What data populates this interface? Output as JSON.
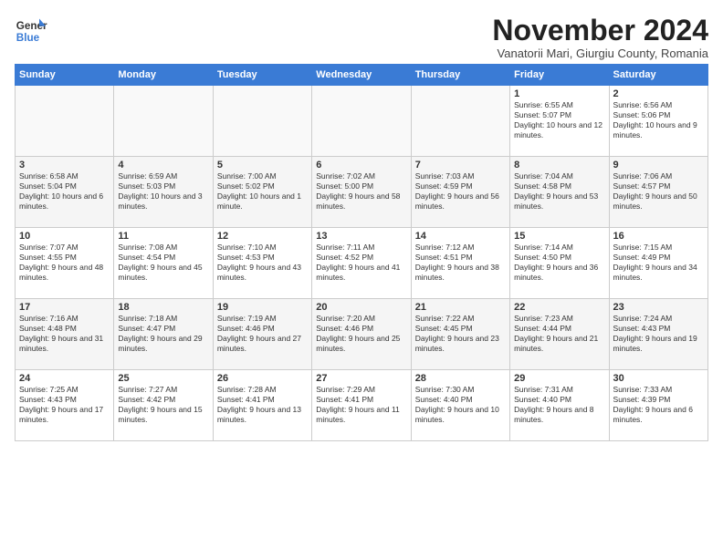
{
  "header": {
    "logo_line1": "General",
    "logo_line2": "Blue",
    "month": "November 2024",
    "location": "Vanatorii Mari, Giurgiu County, Romania"
  },
  "days_of_week": [
    "Sunday",
    "Monday",
    "Tuesday",
    "Wednesday",
    "Thursday",
    "Friday",
    "Saturday"
  ],
  "weeks": [
    [
      {
        "day": "",
        "info": ""
      },
      {
        "day": "",
        "info": ""
      },
      {
        "day": "",
        "info": ""
      },
      {
        "day": "",
        "info": ""
      },
      {
        "day": "",
        "info": ""
      },
      {
        "day": "1",
        "info": "Sunrise: 6:55 AM\nSunset: 5:07 PM\nDaylight: 10 hours and 12 minutes."
      },
      {
        "day": "2",
        "info": "Sunrise: 6:56 AM\nSunset: 5:06 PM\nDaylight: 10 hours and 9 minutes."
      }
    ],
    [
      {
        "day": "3",
        "info": "Sunrise: 6:58 AM\nSunset: 5:04 PM\nDaylight: 10 hours and 6 minutes."
      },
      {
        "day": "4",
        "info": "Sunrise: 6:59 AM\nSunset: 5:03 PM\nDaylight: 10 hours and 3 minutes."
      },
      {
        "day": "5",
        "info": "Sunrise: 7:00 AM\nSunset: 5:02 PM\nDaylight: 10 hours and 1 minute."
      },
      {
        "day": "6",
        "info": "Sunrise: 7:02 AM\nSunset: 5:00 PM\nDaylight: 9 hours and 58 minutes."
      },
      {
        "day": "7",
        "info": "Sunrise: 7:03 AM\nSunset: 4:59 PM\nDaylight: 9 hours and 56 minutes."
      },
      {
        "day": "8",
        "info": "Sunrise: 7:04 AM\nSunset: 4:58 PM\nDaylight: 9 hours and 53 minutes."
      },
      {
        "day": "9",
        "info": "Sunrise: 7:06 AM\nSunset: 4:57 PM\nDaylight: 9 hours and 50 minutes."
      }
    ],
    [
      {
        "day": "10",
        "info": "Sunrise: 7:07 AM\nSunset: 4:55 PM\nDaylight: 9 hours and 48 minutes."
      },
      {
        "day": "11",
        "info": "Sunrise: 7:08 AM\nSunset: 4:54 PM\nDaylight: 9 hours and 45 minutes."
      },
      {
        "day": "12",
        "info": "Sunrise: 7:10 AM\nSunset: 4:53 PM\nDaylight: 9 hours and 43 minutes."
      },
      {
        "day": "13",
        "info": "Sunrise: 7:11 AM\nSunset: 4:52 PM\nDaylight: 9 hours and 41 minutes."
      },
      {
        "day": "14",
        "info": "Sunrise: 7:12 AM\nSunset: 4:51 PM\nDaylight: 9 hours and 38 minutes."
      },
      {
        "day": "15",
        "info": "Sunrise: 7:14 AM\nSunset: 4:50 PM\nDaylight: 9 hours and 36 minutes."
      },
      {
        "day": "16",
        "info": "Sunrise: 7:15 AM\nSunset: 4:49 PM\nDaylight: 9 hours and 34 minutes."
      }
    ],
    [
      {
        "day": "17",
        "info": "Sunrise: 7:16 AM\nSunset: 4:48 PM\nDaylight: 9 hours and 31 minutes."
      },
      {
        "day": "18",
        "info": "Sunrise: 7:18 AM\nSunset: 4:47 PM\nDaylight: 9 hours and 29 minutes."
      },
      {
        "day": "19",
        "info": "Sunrise: 7:19 AM\nSunset: 4:46 PM\nDaylight: 9 hours and 27 minutes."
      },
      {
        "day": "20",
        "info": "Sunrise: 7:20 AM\nSunset: 4:46 PM\nDaylight: 9 hours and 25 minutes."
      },
      {
        "day": "21",
        "info": "Sunrise: 7:22 AM\nSunset: 4:45 PM\nDaylight: 9 hours and 23 minutes."
      },
      {
        "day": "22",
        "info": "Sunrise: 7:23 AM\nSunset: 4:44 PM\nDaylight: 9 hours and 21 minutes."
      },
      {
        "day": "23",
        "info": "Sunrise: 7:24 AM\nSunset: 4:43 PM\nDaylight: 9 hours and 19 minutes."
      }
    ],
    [
      {
        "day": "24",
        "info": "Sunrise: 7:25 AM\nSunset: 4:43 PM\nDaylight: 9 hours and 17 minutes."
      },
      {
        "day": "25",
        "info": "Sunrise: 7:27 AM\nSunset: 4:42 PM\nDaylight: 9 hours and 15 minutes."
      },
      {
        "day": "26",
        "info": "Sunrise: 7:28 AM\nSunset: 4:41 PM\nDaylight: 9 hours and 13 minutes."
      },
      {
        "day": "27",
        "info": "Sunrise: 7:29 AM\nSunset: 4:41 PM\nDaylight: 9 hours and 11 minutes."
      },
      {
        "day": "28",
        "info": "Sunrise: 7:30 AM\nSunset: 4:40 PM\nDaylight: 9 hours and 10 minutes."
      },
      {
        "day": "29",
        "info": "Sunrise: 7:31 AM\nSunset: 4:40 PM\nDaylight: 9 hours and 8 minutes."
      },
      {
        "day": "30",
        "info": "Sunrise: 7:33 AM\nSunset: 4:39 PM\nDaylight: 9 hours and 6 minutes."
      }
    ]
  ]
}
